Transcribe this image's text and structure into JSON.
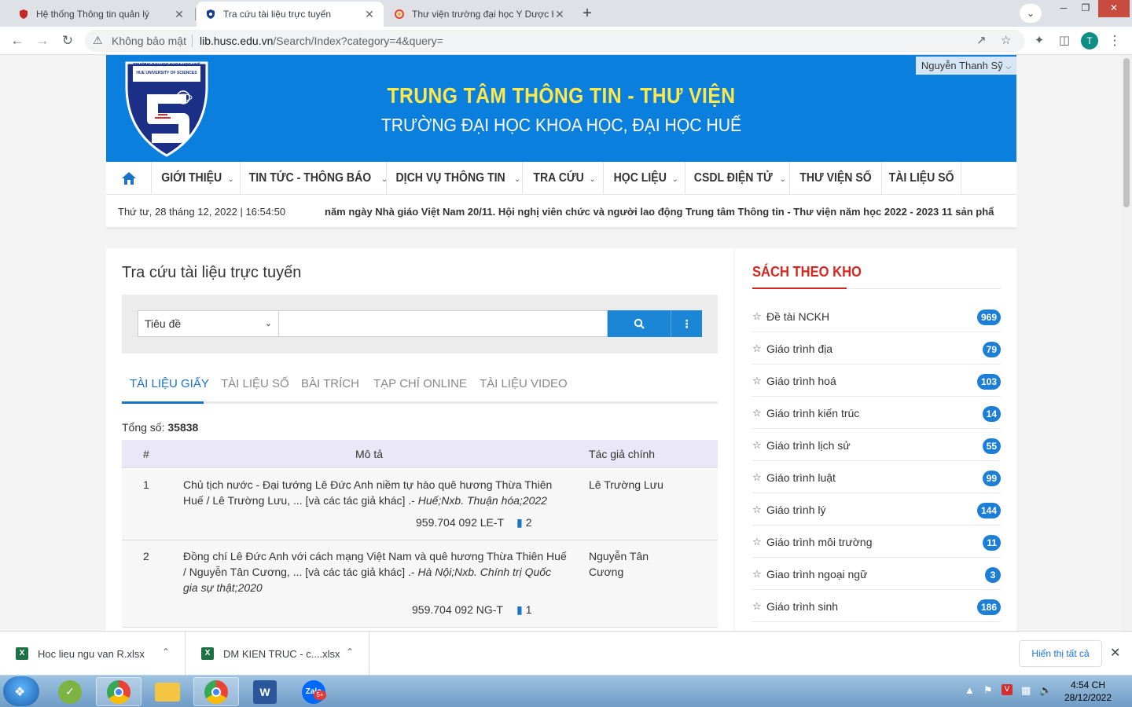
{
  "browser": {
    "tabs": [
      {
        "title": "Hệ thống Thông tin quản lý",
        "active": false
      },
      {
        "title": "Tra cứu tài liệu trực tuyến",
        "active": true
      },
      {
        "title": "Thư viện trường đại học Y Dược H",
        "active": false
      }
    ],
    "close_glyph": "✕",
    "new_tab_glyph": "+",
    "security_label": "Không bảo mật",
    "url_host": "lib.husc.edu.vn",
    "url_path": "/Search/Index?category=4&query=",
    "profile_initial": "T"
  },
  "site": {
    "title": "TRUNG TÂM THÔNG TIN - THƯ VIỆN",
    "subtitle": "TRƯỜNG ĐẠI HỌC KHOA HỌC, ĐẠI HỌC HUẾ",
    "user": "Nguyễn Thanh Sỹ",
    "logo_top": "TRƯỜNG ĐẠI HỌC KHOA HỌC HUẾ",
    "logo_bottom": "HUE UNIVERSITY OF SCIENCES",
    "nav": [
      {
        "label": "GIỚI THIỆU",
        "dropdown": true
      },
      {
        "label": "TIN TỨC - THÔNG BÁO",
        "dropdown": true
      },
      {
        "label": "DỊCH VỤ THÔNG TIN",
        "dropdown": true
      },
      {
        "label": "TRA CỨU",
        "dropdown": true
      },
      {
        "label": "HỌC LIỆU",
        "dropdown": true
      },
      {
        "label": "CSDL ĐIỆN TỬ",
        "dropdown": true
      },
      {
        "label": "THƯ VIỆN SỐ",
        "dropdown": false
      },
      {
        "label": "TÀI LIỆU SỐ",
        "dropdown": false
      }
    ],
    "datetime": "Thứ tư, 28 tháng 12, 2022 | 16:54:50",
    "ticker": "năm ngày Nhà giáo Việt Nam 20/11.  Hội nghị viên chức và người lao động Trung tâm Thông tin - Thư viện năm học 2022 - 2023  11 sản phẩ"
  },
  "search": {
    "heading": "Tra cứu tài liệu trực tuyến",
    "field_selected": "Tiêu đề",
    "query": "",
    "tabs": [
      "TÀI LIỆU GIẤY",
      "TÀI LIỆU SỐ",
      "BÀI TRÍCH",
      "TẠP CHÍ ONLINE",
      "TÀI LIỆU VIDEO"
    ],
    "active_tab": 0,
    "total_label": "Tổng số:",
    "total_value": "35838",
    "columns": [
      "#",
      "Mô tả",
      "Tác giả chính"
    ],
    "rows": [
      {
        "no": "1",
        "desc": "Chủ tịch nước - Đại tướng Lê Đức Anh niềm tự hào quê hương Thừa Thiên Huế / Lê Trường Lưu, ... [và các tác giả khác] .- ",
        "desc_italic": "Huế;Nxb. Thuận hóa;2022",
        "callno": "959.704 092 LE-T",
        "copies": "2",
        "author": "Lê Trường Lưu"
      },
      {
        "no": "2",
        "desc": "Đồng chí Lê Đức Anh với cách mạng Việt Nam và quê hương Thừa Thiên Huế / Nguyễn Tân Cương, ... [và các tác giả khác] .- ",
        "desc_italic": "Hà Nội;Nxb. Chính trị Quốc gia sự thật;2020",
        "callno": "959.704 092 NG-T",
        "copies": "1",
        "author": "Nguyễn Tân Cương"
      }
    ]
  },
  "sidebar": {
    "title": "SÁCH THEO KHO",
    "items": [
      {
        "label": "Đề tài NCKH",
        "count": "969"
      },
      {
        "label": "Giáo trình địa",
        "count": "79"
      },
      {
        "label": "Giáo trình hoá",
        "count": "103"
      },
      {
        "label": "Giáo trình kiến trúc",
        "count": "14"
      },
      {
        "label": "Giáo trình lịch sử",
        "count": "55"
      },
      {
        "label": "Giáo trình luật",
        "count": "99"
      },
      {
        "label": "Giáo trình lý",
        "count": "144"
      },
      {
        "label": "Giáo trình môi trường",
        "count": "11"
      },
      {
        "label": "Giao trình ngoại ngữ",
        "count": "3"
      },
      {
        "label": "Giáo trình sinh",
        "count": "186"
      }
    ]
  },
  "downloads": {
    "items": [
      "Hoc lieu ngu van R.xlsx",
      "DM KIEN TRUC - c....xlsx"
    ],
    "show_all": "Hiển thị tất cả"
  },
  "taskbar": {
    "zalo_label": "Zalo",
    "zalo_badge": "5+",
    "time": "4:54 CH",
    "date": "28/12/2022"
  },
  "colors": {
    "banner": "#0a7fde",
    "title_yellow": "#ffe84a",
    "accent_blue": "#1c86d6",
    "sidebar_red": "#d7261f"
  }
}
